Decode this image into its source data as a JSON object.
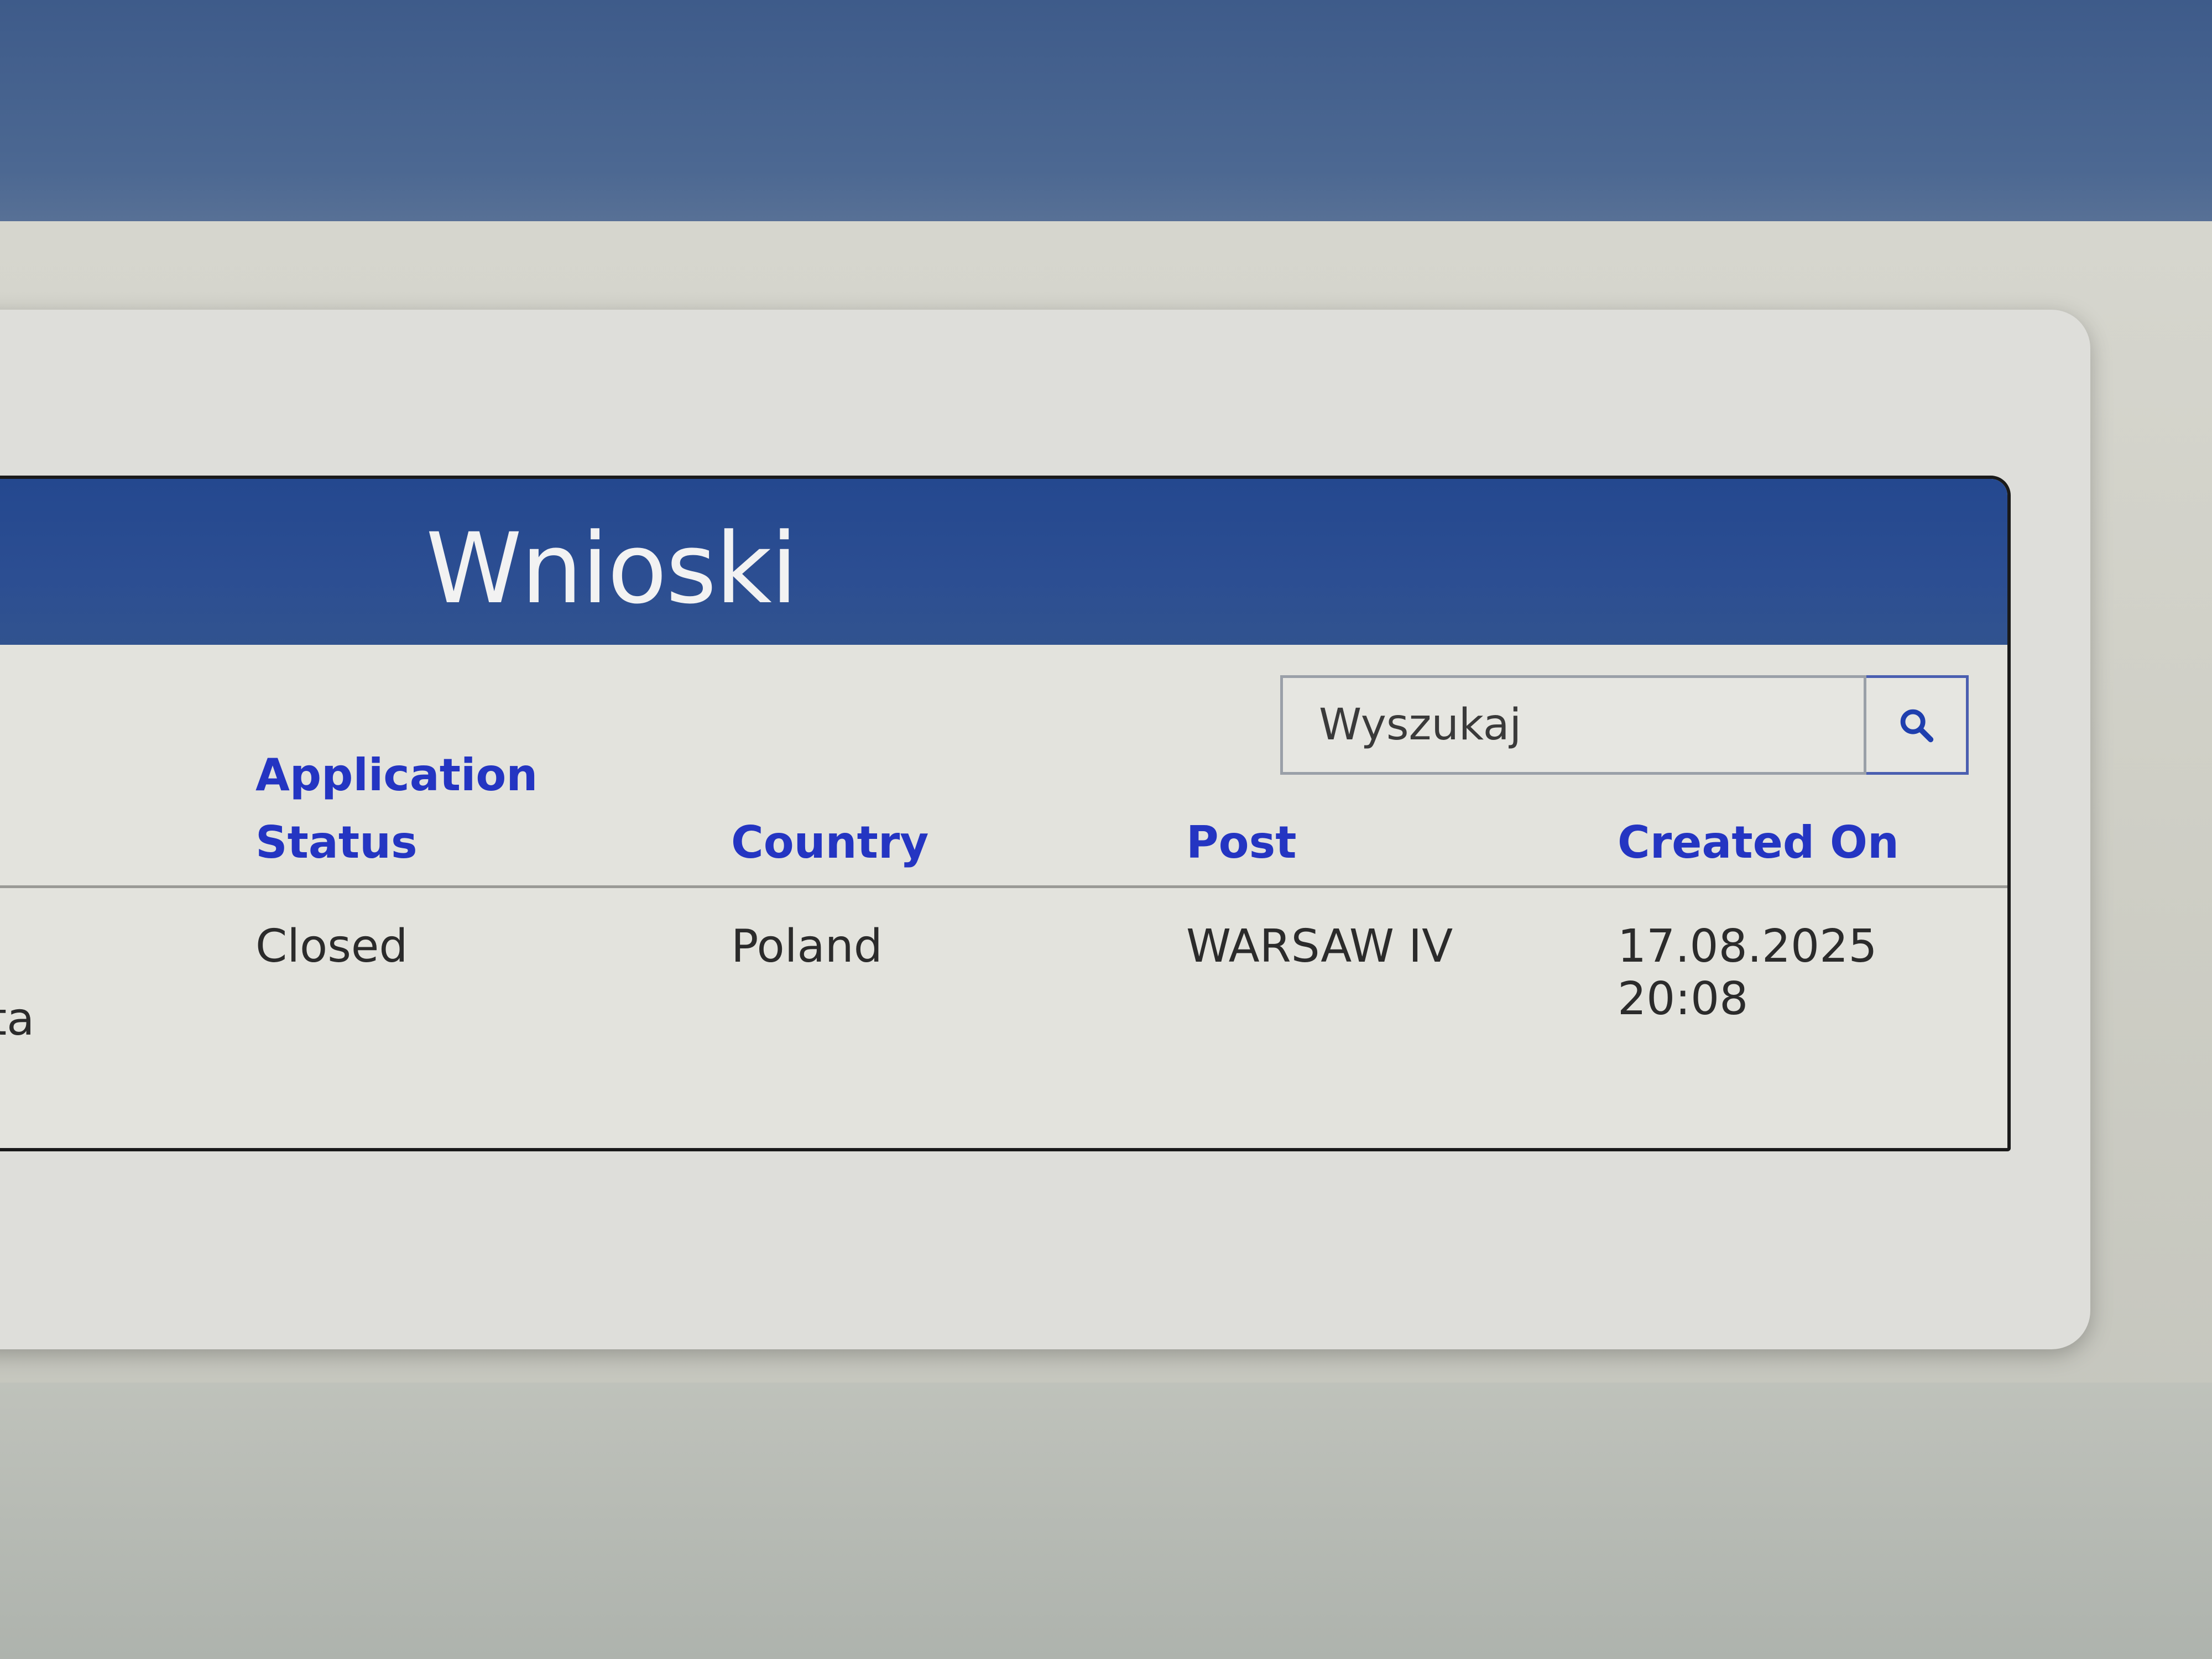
{
  "page": {
    "title": "Wnioski"
  },
  "search": {
    "placeholder": "Wyszukaj",
    "button_icon": "search-icon"
  },
  "table": {
    "headers": {
      "status": "Application Status",
      "country": "Country",
      "post": "Post",
      "created_on": "Created On"
    },
    "rows": [
      {
        "leading_text_cut": "ta",
        "status": "Closed",
        "country": "Poland",
        "post": "WARSAW IV",
        "created_on": "17.08.2025 20:08"
      }
    ]
  },
  "colors": {
    "header_bg": "#2c4e92",
    "link": "#2435c2",
    "text": "#2b2b2b"
  }
}
